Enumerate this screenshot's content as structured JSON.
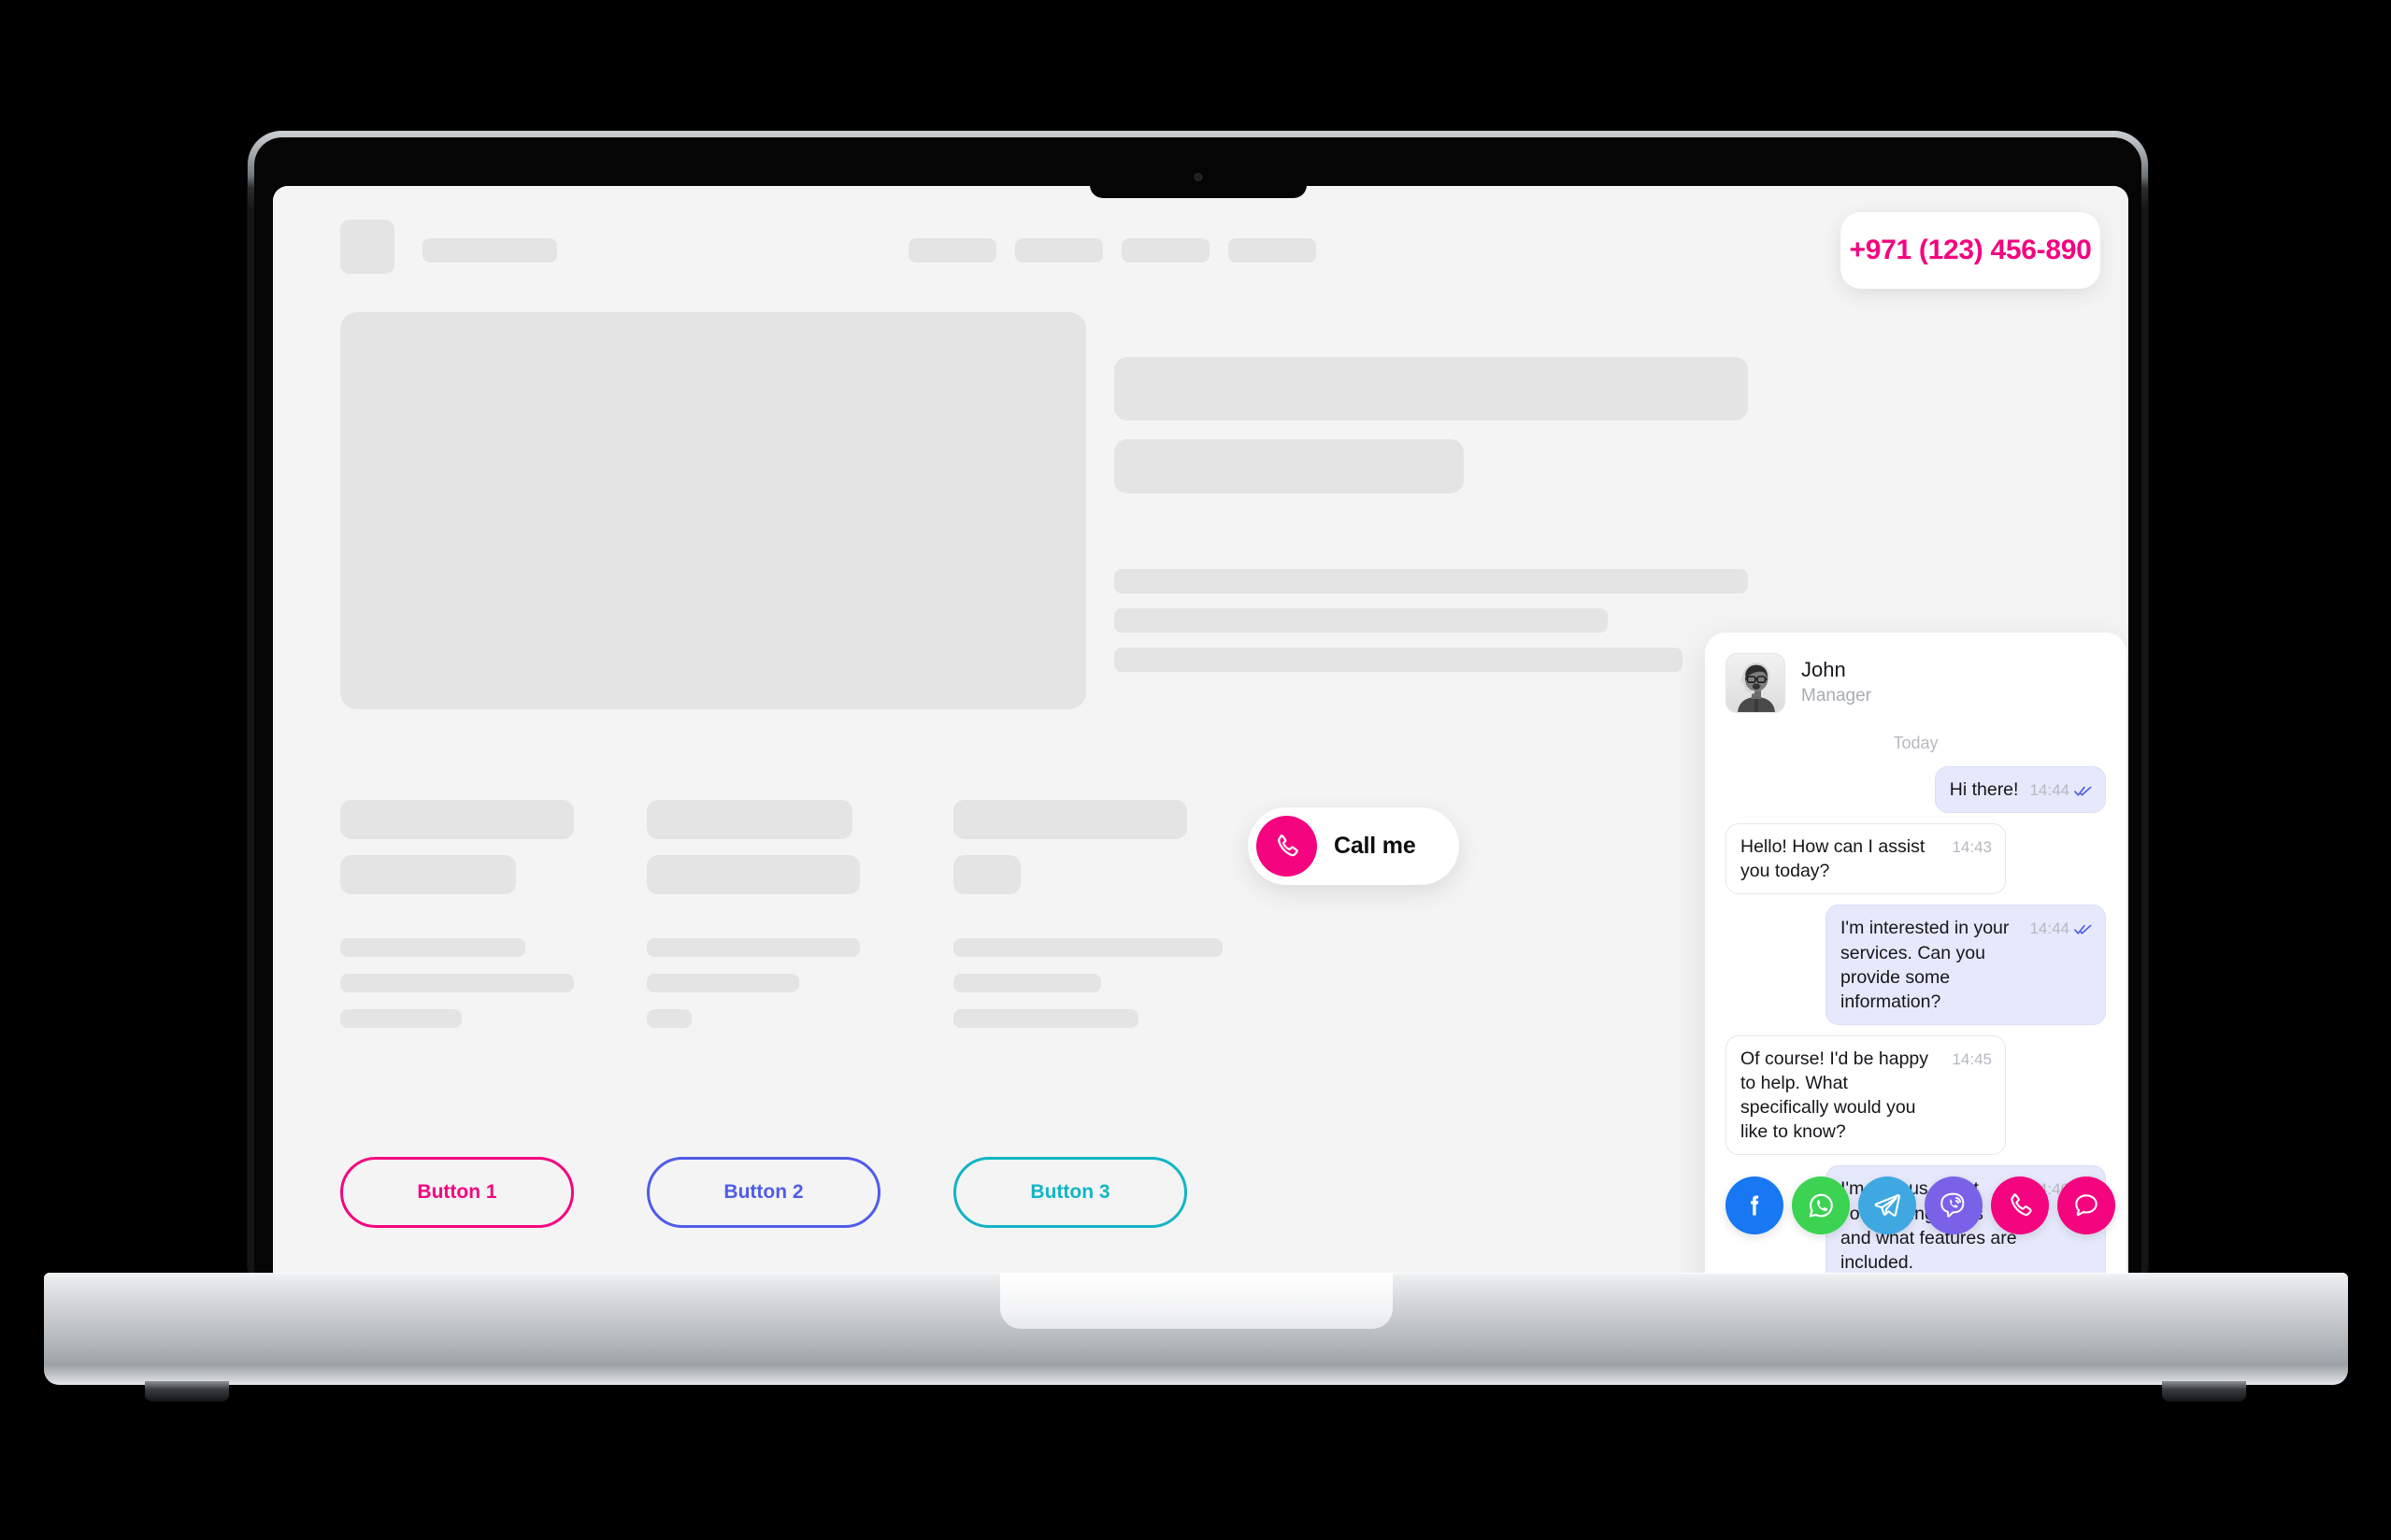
{
  "header": {
    "phone_badge": "+971 (123) 456-890",
    "nav_placeholder_count": 4
  },
  "hero": {
    "call_me_label": "Call me",
    "call_me_icon": "phone-handset-icon"
  },
  "buttons": [
    {
      "label": "Button 1",
      "color": "#f4047f"
    },
    {
      "label": "Button 2",
      "color": "#4f5ce8"
    },
    {
      "label": "Button 3",
      "color": "#12b5c4"
    }
  ],
  "chat": {
    "agent_name": "John",
    "agent_role": "Manager",
    "avatar_alt": "agent-photo",
    "day_divider": "Today",
    "messages": [
      {
        "direction": "out",
        "text": "Hi there!",
        "time": "14:44",
        "read": true,
        "one_line": true
      },
      {
        "direction": "in",
        "text": "Hello! How can I assist you today?",
        "time": "14:43",
        "read": false,
        "one_line": false
      },
      {
        "direction": "out",
        "text": "I'm interested in your services. Can you provide some information?",
        "time": "14:44",
        "read": true,
        "one_line": false
      },
      {
        "direction": "in",
        "text": "Of course! I'd be happy to help. What specifically would you like to know?",
        "time": "14:45",
        "read": false,
        "one_line": false
      },
      {
        "direction": "out",
        "text": "I'm curious about your pricing plans and what features are included.",
        "time": "14:46",
        "read": true,
        "one_line": false
      }
    ]
  },
  "social": [
    {
      "name": "facebook",
      "color": "#1877f2"
    },
    {
      "name": "whatsapp",
      "color": "#3cd353"
    },
    {
      "name": "telegram",
      "color": "#3fa8e0"
    },
    {
      "name": "viber",
      "color": "#7a62e8"
    },
    {
      "name": "phone",
      "color": "#f4047f"
    },
    {
      "name": "chat",
      "color": "#f4047f"
    }
  ],
  "theme": {
    "accent_pink": "#f4047f",
    "accent_blue": "#4f5ce8",
    "accent_teal": "#12b5c4",
    "page_background": "#f4f4f5",
    "skeleton": "#e4e4e4",
    "outer_background": "#000000"
  }
}
